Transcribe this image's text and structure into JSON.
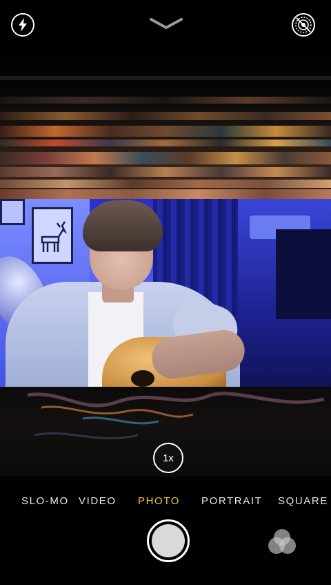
{
  "top_bar": {
    "flash_icon": "flash-icon",
    "chevron_icon": "chevron-down-icon",
    "live_photo_icon": "live-photo-off-icon"
  },
  "zoom": {
    "label": "1x"
  },
  "modes": {
    "items": [
      "SLO-MO",
      "VIDEO",
      "PHOTO",
      "PORTRAIT",
      "SQUARE"
    ],
    "selected": "PHOTO"
  },
  "controls": {
    "shutter_icon": "shutter-button",
    "filters_icon": "filters-icon"
  },
  "colors": {
    "accent": "#f6c343",
    "background": "#000000",
    "icon": "#ffffff"
  }
}
